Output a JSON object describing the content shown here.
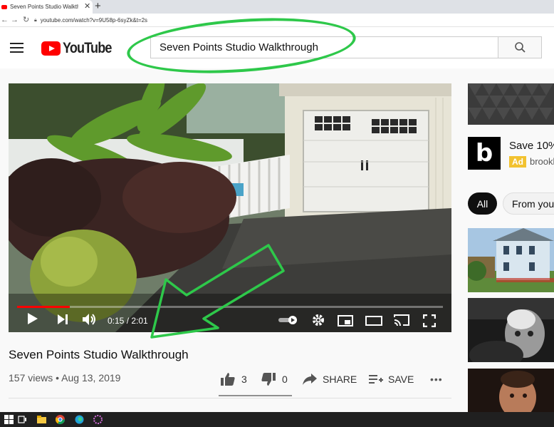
{
  "browser": {
    "tab_title": "Seven Points Studio Walkthrough",
    "tab_close": "✕",
    "new_tab": "+",
    "url": "youtube.com/watch?v=9U58p-6syZk&t=2s"
  },
  "header": {
    "logo_text": "YouTube",
    "search_value": "Seven Points Studio Walkthrough"
  },
  "player": {
    "time": "0:15 / 2:01",
    "progress": 0.124
  },
  "video": {
    "title": "Seven Points Studio Walkthrough",
    "meta": "157 views • Aug 13, 2019",
    "likes": "3",
    "dislikes": "0",
    "share_label": "SHARE",
    "save_label": "SAVE",
    "more_label": "•••"
  },
  "sidebar": {
    "ad_logo": "b",
    "ad_title": "Save 10%",
    "ad_badge": "Ad",
    "ad_domain": "brooklinen.com",
    "chips": [
      "All",
      "From your search"
    ]
  },
  "colors": {
    "brand_red": "#ff0000",
    "annotation_green": "#2ec84a",
    "ad_badge": "#f2c230"
  }
}
